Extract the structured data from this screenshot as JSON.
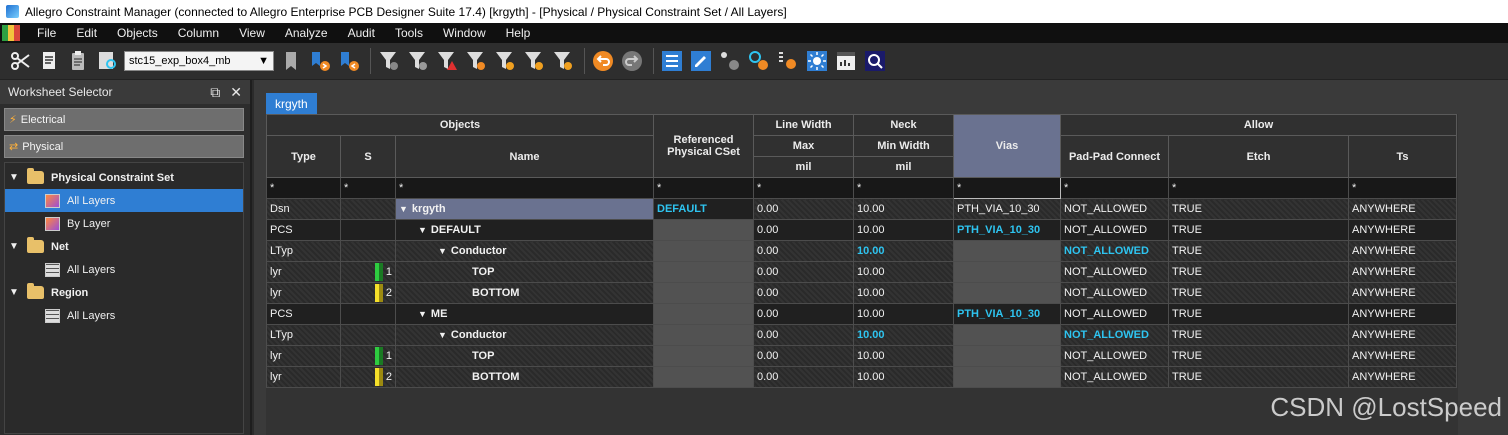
{
  "window": {
    "title": "Allegro Constraint Manager (connected to Allegro Enterprise PCB Designer Suite 17.4) [krgyth] - [Physical / Physical Constraint Set / All Layers]"
  },
  "menu": [
    "File",
    "Edit",
    "Objects",
    "Column",
    "View",
    "Analyze",
    "Audit",
    "Tools",
    "Window",
    "Help"
  ],
  "toolbar": {
    "design_combo": "stc15_exp_box4_mb"
  },
  "sidebar": {
    "title": "Worksheet Selector",
    "groups": [
      {
        "label": "Electrical",
        "icon": "lightning-icon"
      },
      {
        "label": "Physical",
        "icon": "arrows-icon"
      }
    ],
    "tree": [
      {
        "label": "Physical Constraint Set",
        "children": [
          "All Layers",
          "By Layer"
        ]
      },
      {
        "label": "Net",
        "children": [
          "All Layers"
        ]
      },
      {
        "label": "Region",
        "children": [
          "All Layers"
        ]
      }
    ]
  },
  "worksheet": {
    "tab": "krgyth",
    "headers": {
      "objects": "Objects",
      "type": "Type",
      "s": "S",
      "name": "Name",
      "ref_cset": "Referenced Physical CSet",
      "line_width": "Line Width",
      "max": "Max",
      "neck": "Neck",
      "min_width": "Min Width",
      "vias": "Vias",
      "allow": "Allow",
      "pad_pad": "Pad-Pad Connect",
      "etch": "Etch",
      "ts": "Ts",
      "unit": "mil",
      "filter": "*"
    },
    "rows": [
      {
        "type": "Dsn",
        "s": "",
        "name": "krgyth",
        "ref": "DEFAULT",
        "lw": "0.00",
        "neck": "10.00",
        "vias": "PTH_VIA_10_30",
        "pad": "NOT_ALLOWED",
        "etch": "TRUE",
        "ts": "ANYWHERE"
      },
      {
        "type": "PCS",
        "s": "",
        "name": "DEFAULT",
        "ref": "",
        "lw": "0.00",
        "neck": "10.00",
        "vias": "PTH_VIA_10_30",
        "pad": "NOT_ALLOWED",
        "etch": "TRUE",
        "ts": "ANYWHERE"
      },
      {
        "type": "LTyp",
        "s": "",
        "name": "Conductor",
        "ref": "",
        "lw": "0.00",
        "neck": "10.00",
        "vias": "",
        "pad": "NOT_ALLOWED",
        "etch": "TRUE",
        "ts": "ANYWHERE"
      },
      {
        "type": "lyr",
        "s": "1",
        "name": "TOP",
        "ref": "",
        "lw": "0.00",
        "neck": "10.00",
        "vias": "",
        "pad": "NOT_ALLOWED",
        "etch": "TRUE",
        "ts": "ANYWHERE"
      },
      {
        "type": "lyr",
        "s": "2",
        "name": "BOTTOM",
        "ref": "",
        "lw": "0.00",
        "neck": "10.00",
        "vias": "",
        "pad": "NOT_ALLOWED",
        "etch": "TRUE",
        "ts": "ANYWHERE"
      },
      {
        "type": "PCS",
        "s": "",
        "name": "ME",
        "ref": "",
        "lw": "0.00",
        "neck": "10.00",
        "vias": "PTH_VIA_10_30",
        "pad": "NOT_ALLOWED",
        "etch": "TRUE",
        "ts": "ANYWHERE"
      },
      {
        "type": "LTyp",
        "s": "",
        "name": "Conductor",
        "ref": "",
        "lw": "0.00",
        "neck": "10.00",
        "vias": "",
        "pad": "NOT_ALLOWED",
        "etch": "TRUE",
        "ts": "ANYWHERE"
      },
      {
        "type": "lyr",
        "s": "1",
        "name": "TOP",
        "ref": "",
        "lw": "0.00",
        "neck": "10.00",
        "vias": "",
        "pad": "NOT_ALLOWED",
        "etch": "TRUE",
        "ts": "ANYWHERE"
      },
      {
        "type": "lyr",
        "s": "2",
        "name": "BOTTOM",
        "ref": "",
        "lw": "0.00",
        "neck": "10.00",
        "vias": "",
        "pad": "NOT_ALLOWED",
        "etch": "TRUE",
        "ts": "ANYWHERE"
      }
    ]
  },
  "watermark": "CSDN @LostSpeed"
}
